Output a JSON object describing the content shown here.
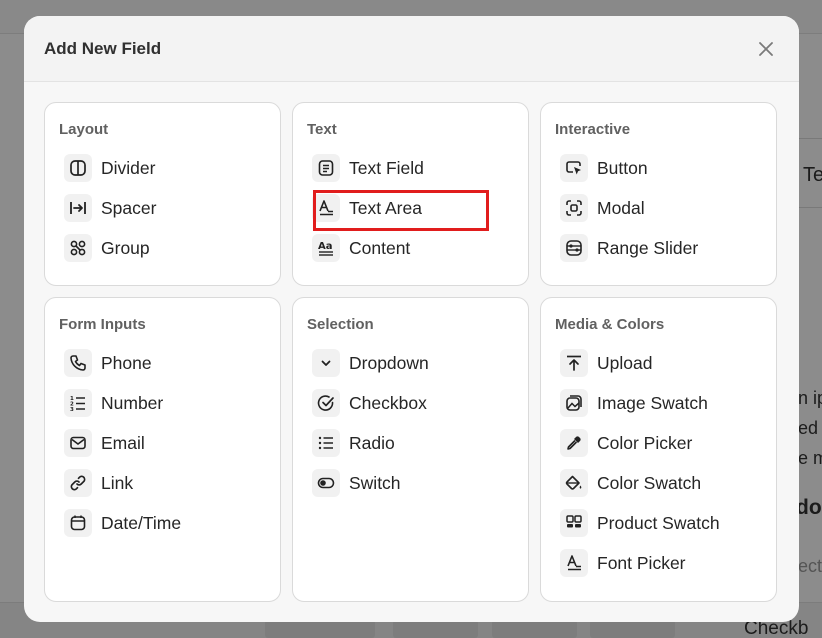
{
  "modal": {
    "title": "Add New Field"
  },
  "background": {
    "fragments": [
      "Te",
      "n ip",
      "ed",
      "e m",
      "do",
      "ect",
      "Checkb"
    ]
  },
  "groups": [
    {
      "title": "Layout",
      "items": [
        {
          "label": "Divider",
          "icon": "divider-icon"
        },
        {
          "label": "Spacer",
          "icon": "spacer-icon"
        },
        {
          "label": "Group",
          "icon": "group-icon"
        }
      ]
    },
    {
      "title": "Text",
      "items": [
        {
          "label": "Text Field",
          "icon": "text-field-icon"
        },
        {
          "label": "Text Area",
          "icon": "text-area-icon",
          "highlighted": true
        },
        {
          "label": "Content",
          "icon": "content-icon"
        }
      ]
    },
    {
      "title": "Interactive",
      "items": [
        {
          "label": "Button",
          "icon": "button-cursor-icon"
        },
        {
          "label": "Modal",
          "icon": "modal-icon"
        },
        {
          "label": "Range Slider",
          "icon": "range-slider-icon"
        }
      ]
    },
    {
      "title": "Form Inputs",
      "items": [
        {
          "label": "Phone",
          "icon": "phone-icon"
        },
        {
          "label": "Number",
          "icon": "number-list-icon"
        },
        {
          "label": "Email",
          "icon": "email-icon"
        },
        {
          "label": "Link",
          "icon": "link-icon"
        },
        {
          "label": "Date/Time",
          "icon": "calendar-icon"
        }
      ]
    },
    {
      "title": "Selection",
      "items": [
        {
          "label": "Dropdown",
          "icon": "chevron-down-icon"
        },
        {
          "label": "Checkbox",
          "icon": "check-circle-icon"
        },
        {
          "label": "Radio",
          "icon": "radio-list-icon"
        },
        {
          "label": "Switch",
          "icon": "toggle-icon"
        }
      ]
    },
    {
      "title": "Media & Colors",
      "items": [
        {
          "label": "Upload",
          "icon": "upload-icon"
        },
        {
          "label": "Image Swatch",
          "icon": "image-swatch-icon"
        },
        {
          "label": "Color Picker",
          "icon": "eyedropper-icon"
        },
        {
          "label": "Color Swatch",
          "icon": "paint-bucket-icon"
        },
        {
          "label": "Product Swatch",
          "icon": "product-swatch-icon"
        },
        {
          "label": "Font Picker",
          "icon": "font-picker-icon"
        }
      ]
    }
  ],
  "colors": {
    "highlight": "#e11d1d"
  }
}
